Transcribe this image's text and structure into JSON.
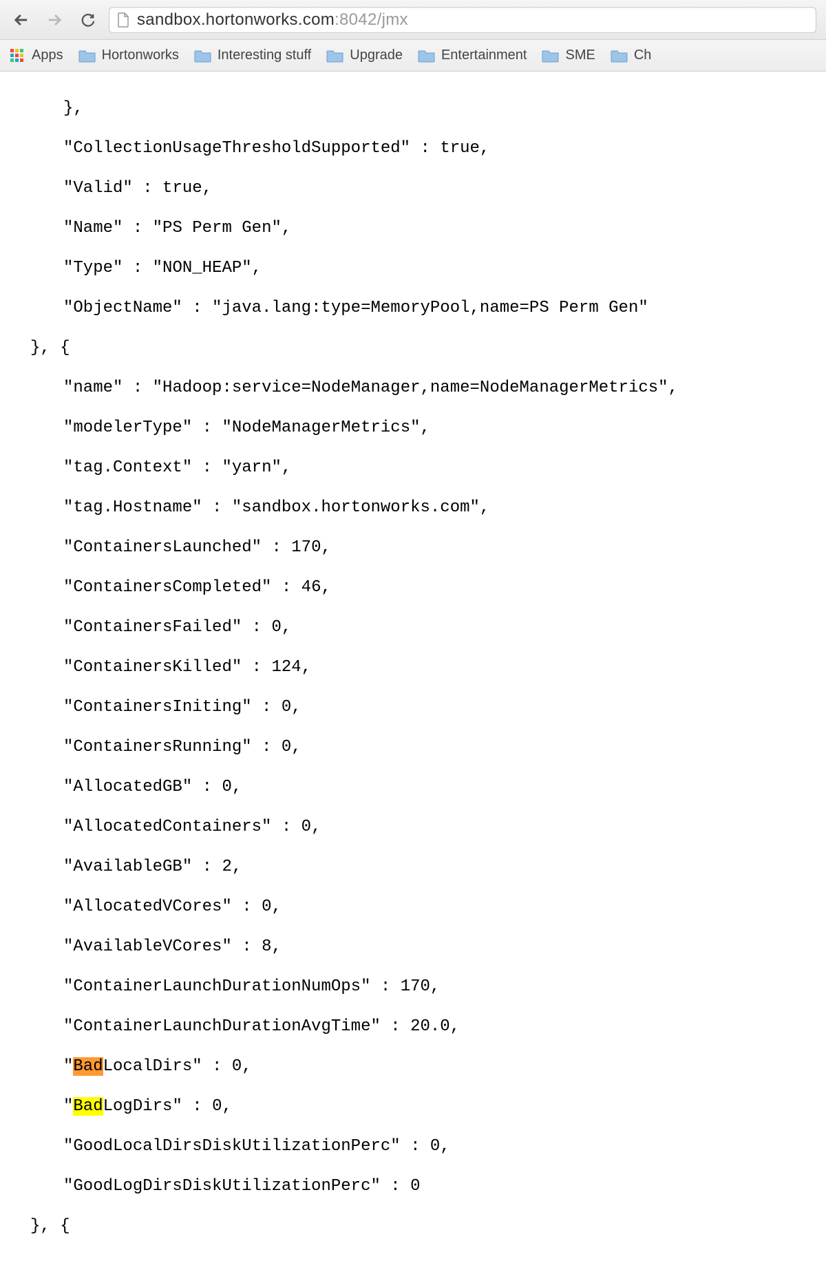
{
  "toolbar": {
    "url_domain": "sandbox.hortonworks.com",
    "url_port": ":8042",
    "url_path": "/jmx"
  },
  "bookmarks": {
    "apps_label": "Apps",
    "folders": [
      "Hortonworks",
      "Interesting stuff",
      "Upgrade",
      "Entertainment",
      "SME",
      "Ch"
    ]
  },
  "jmx": {
    "line_close_brace": "},",
    "block1": {
      "collection_supported_key": "\"CollectionUsageThresholdSupported\"",
      "collection_supported_val": "true",
      "valid_key": "\"Valid\"",
      "valid_val": "true",
      "name_key": "\"Name\"",
      "name_val": "\"PS Perm Gen\"",
      "type_key": "\"Type\"",
      "type_val": "\"NON_HEAP\"",
      "objname_key": "\"ObjectName\"",
      "objname_val": "\"java.lang:type=MemoryPool,name=PS Perm Gen\""
    },
    "close_open": "}, {",
    "block2": {
      "name_key": "\"name\"",
      "name_val": "\"Hadoop:service=NodeManager,name=NodeManagerMetrics\"",
      "modeler_key": "\"modelerType\"",
      "modeler_val": "\"NodeManagerMetrics\"",
      "context_key": "\"tag.Context\"",
      "context_val": "\"yarn\"",
      "hostname_key": "\"tag.Hostname\"",
      "hostname_val": "\"sandbox.hortonworks.com\"",
      "launched_key": "\"ContainersLaunched\"",
      "launched_val": "170",
      "completed_key": "\"ContainersCompleted\"",
      "completed_val": "46",
      "failed_key": "\"ContainersFailed\"",
      "failed_val": "0",
      "killed_key": "\"ContainersKilled\"",
      "killed_val": "124",
      "initing_key": "\"ContainersIniting\"",
      "initing_val": "0",
      "running_key": "\"ContainersRunning\"",
      "running_val": "0",
      "allocgb_key": "\"AllocatedGB\"",
      "allocgb_val": "0",
      "alloccont_key": "\"AllocatedContainers\"",
      "alloccont_val": "0",
      "availgb_key": "\"AvailableGB\"",
      "availgb_val": "2",
      "allocvcores_key": "\"AllocatedVCores\"",
      "allocvcores_val": "0",
      "availvcores_key": "\"AvailableVCores\"",
      "availvcores_val": "8",
      "numops_key": "\"ContainerLaunchDurationNumOps\"",
      "numops_val": "170",
      "avgtime_key": "\"ContainerLaunchDurationAvgTime\"",
      "avgtime_val": "20.0",
      "bad_prefix": "Bad",
      "badlocal_suffix": "LocalDirs\"",
      "badlocal_val": "0",
      "badlog_suffix": "LogDirs\"",
      "badlog_val": "0",
      "goodlocal_key": "\"GoodLocalDirsDiskUtilizationPerc\"",
      "goodlocal_val": "0",
      "goodlog_key": "\"GoodLogDirsDiskUtilizationPerc\"",
      "goodlog_val": "0"
    }
  }
}
